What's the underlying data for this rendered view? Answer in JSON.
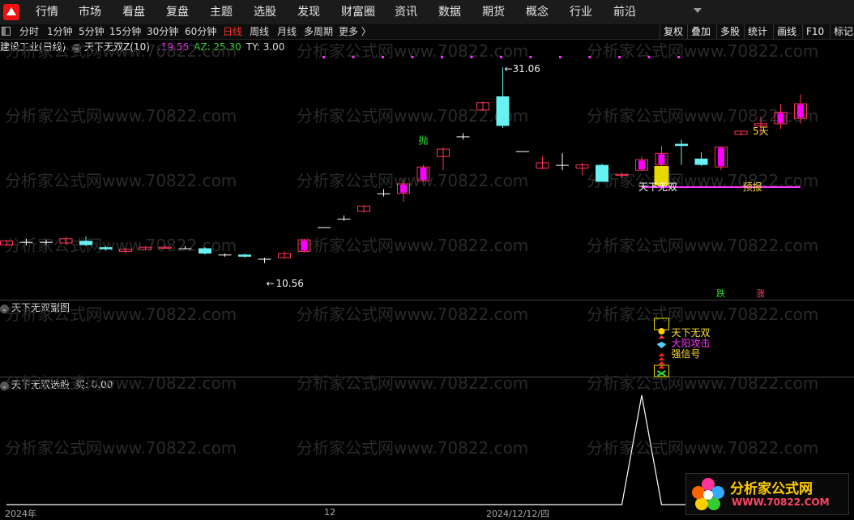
{
  "menu": {
    "items": [
      "行情",
      "市场",
      "看盘",
      "复盘",
      "主题",
      "选股",
      "发现",
      "财富圈",
      "资讯",
      "数据",
      "期货",
      "概念",
      "行业",
      "前沿"
    ]
  },
  "toolbar": {
    "periods": [
      "分时",
      "1分钟",
      "5分钟",
      "15分钟",
      "30分钟",
      "60分钟",
      "日线",
      "周线",
      "月线",
      "多周期",
      "更多 〉"
    ],
    "active_period": "日线",
    "tools": [
      "复权",
      "叠加",
      "多股",
      "统计",
      "画线",
      "F10",
      "标记"
    ]
  },
  "info": {
    "stock": "建设工业(日线)",
    "indicator": "天下无双Z(10)",
    "values": [
      {
        "text": ":19.56",
        "color": "#ff33ff"
      },
      {
        "text": "AZ: 25.30",
        "color": "#33dd33"
      },
      {
        "text": "TY: 3.00",
        "color": "#dddddd"
      }
    ]
  },
  "main_chart": {
    "high_label": "31.06",
    "low_label": "10.56",
    "signal_label": "天下无双",
    "forecast_label": "预报",
    "days_label": "5天",
    "throw_label": "抛",
    "fall_label": "跌",
    "rise_label": "涨"
  },
  "chart_data": [
    {
      "type": "candlestick",
      "title": "",
      "price_range": [
        10.56,
        31.06
      ],
      "candles": [
        {
          "open": 14.2,
          "close": 14.6,
          "high": 14.7,
          "low": 14.1
        },
        {
          "open": 14.5,
          "close": 14.5,
          "high": 14.8,
          "low": 14.2
        },
        {
          "open": 14.5,
          "close": 14.5,
          "high": 14.7,
          "low": 14.2
        },
        {
          "open": 14.4,
          "close": 14.8,
          "high": 15.0,
          "low": 14.2
        },
        {
          "open": 14.6,
          "close": 14.2,
          "high": 15.0,
          "low": 14.1
        },
        {
          "open": 14.0,
          "close": 13.8,
          "high": 14.1,
          "low": 13.7
        },
        {
          "open": 13.6,
          "close": 13.8,
          "high": 13.9,
          "low": 13.4
        },
        {
          "open": 13.8,
          "close": 14.0,
          "high": 14.1,
          "low": 13.7
        },
        {
          "open": 13.9,
          "close": 14.0,
          "high": 14.2,
          "low": 13.9
        },
        {
          "open": 13.9,
          "close": 13.9,
          "high": 14.1,
          "low": 13.8
        },
        {
          "open": 13.9,
          "close": 13.4,
          "high": 14.0,
          "low": 13.3
        },
        {
          "open": 13.3,
          "close": 13.3,
          "high": 13.4,
          "low": 13.1
        },
        {
          "open": 13.3,
          "close": 13.1,
          "high": 13.4,
          "low": 13.0
        },
        {
          "open": 12.9,
          "close": 12.9,
          "high": 13.0,
          "low": 12.5
        },
        {
          "open": 13.0,
          "close": 13.4,
          "high": 13.6,
          "low": 12.9
        },
        {
          "open": 13.6,
          "close": 14.7,
          "high": 14.8,
          "low": 13.5
        },
        {
          "open": 15.9,
          "close": 15.9,
          "high": 15.9,
          "low": 15.9
        },
        {
          "open": 16.7,
          "close": 16.7,
          "high": 17.0,
          "low": 16.5
        },
        {
          "open": 17.4,
          "close": 17.9,
          "high": 18.0,
          "low": 17.3
        },
        {
          "open": 19.1,
          "close": 19.1,
          "high": 19.5,
          "low": 18.8
        },
        {
          "open": 19.1,
          "close": 20.0,
          "high": 20.5,
          "low": 18.3
        },
        {
          "open": 20.3,
          "close": 21.6,
          "high": 21.8,
          "low": 20.2
        },
        {
          "open": 22.6,
          "close": 23.3,
          "high": 23.5,
          "low": 21.3
        },
        {
          "open": 24.5,
          "close": 24.5,
          "high": 24.8,
          "low": 24.2
        },
        {
          "open": 27.0,
          "close": 27.7,
          "high": 27.8,
          "low": 26.9
        },
        {
          "open": 28.3,
          "close": 25.5,
          "high": 31.06,
          "low": 25.3
        },
        {
          "open": 23.1,
          "close": 23.1,
          "high": 23.1,
          "low": 23.1
        },
        {
          "open": 21.5,
          "close": 22.0,
          "high": 22.6,
          "low": 21.4
        },
        {
          "open": 21.8,
          "close": 21.8,
          "high": 22.9,
          "low": 21.3
        },
        {
          "open": 21.5,
          "close": 21.8,
          "high": 22.0,
          "low": 20.8
        },
        {
          "open": 21.8,
          "close": 20.2,
          "high": 21.9,
          "low": 20.2
        },
        {
          "open": 20.8,
          "close": 20.9,
          "high": 21.1,
          "low": 20.5
        },
        {
          "open": 21.3,
          "close": 22.3,
          "high": 22.6,
          "low": 21.2
        },
        {
          "open": 21.8,
          "close": 22.9,
          "high": 23.6,
          "low": 21.7
        },
        {
          "open": 23.8,
          "close": 23.6,
          "high": 24.2,
          "low": 21.8
        },
        {
          "open": 22.4,
          "close": 21.8,
          "high": 23.0,
          "low": 21.7
        },
        {
          "open": 21.6,
          "close": 23.5,
          "high": 23.5,
          "low": 21.3
        },
        {
          "open": 24.7,
          "close": 25.0,
          "high": 25.0,
          "low": 24.6
        },
        {
          "open": 25.5,
          "close": 25.7,
          "high": 26.4,
          "low": 24.8
        },
        {
          "open": 25.7,
          "close": 26.8,
          "high": 27.6,
          "low": 25.2
        },
        {
          "open": 26.2,
          "close": 27.6,
          "high": 28.5,
          "low": 25.7
        }
      ]
    },
    {
      "type": "line",
      "title": "天下无双选股",
      "series": [
        {
          "name": "买",
          "values": [
            0,
            0,
            0,
            0,
            0,
            0,
            0,
            0,
            0,
            0,
            0,
            0,
            0,
            0,
            0,
            0,
            0,
            0,
            0,
            0,
            0,
            0,
            0,
            0,
            0,
            0,
            0,
            0,
            0,
            0,
            0,
            0,
            1,
            0,
            0,
            0,
            0,
            0,
            0,
            0,
            0
          ]
        }
      ],
      "ylim": [
        0,
        1
      ]
    }
  ],
  "sub1": {
    "title": "天下无双副图",
    "labels": [
      {
        "text": "天下无双",
        "color": "#ffdd33"
      },
      {
        "text": "大阳攻击",
        "color": "#ff33ff"
      },
      {
        "text": "强信号",
        "color": "#ffdd33"
      }
    ]
  },
  "sub2": {
    "title": "天下无双选股",
    "buy_label": "买: 0.00"
  },
  "xaxis": {
    "labels": [
      "2024年",
      "12",
      "2024/12/12/四"
    ]
  },
  "watermark": "分析家公式网www.70822.com",
  "brand": {
    "name": "分析家公式网",
    "url": "WWW.70822.COM"
  },
  "colors": {
    "up": "#ff3355",
    "up_fill": "#ff00ff",
    "down": "#66f2f2",
    "flat": "#ffffff",
    "signal_line": "#ff33ff",
    "accent_red": "#ff3030"
  }
}
